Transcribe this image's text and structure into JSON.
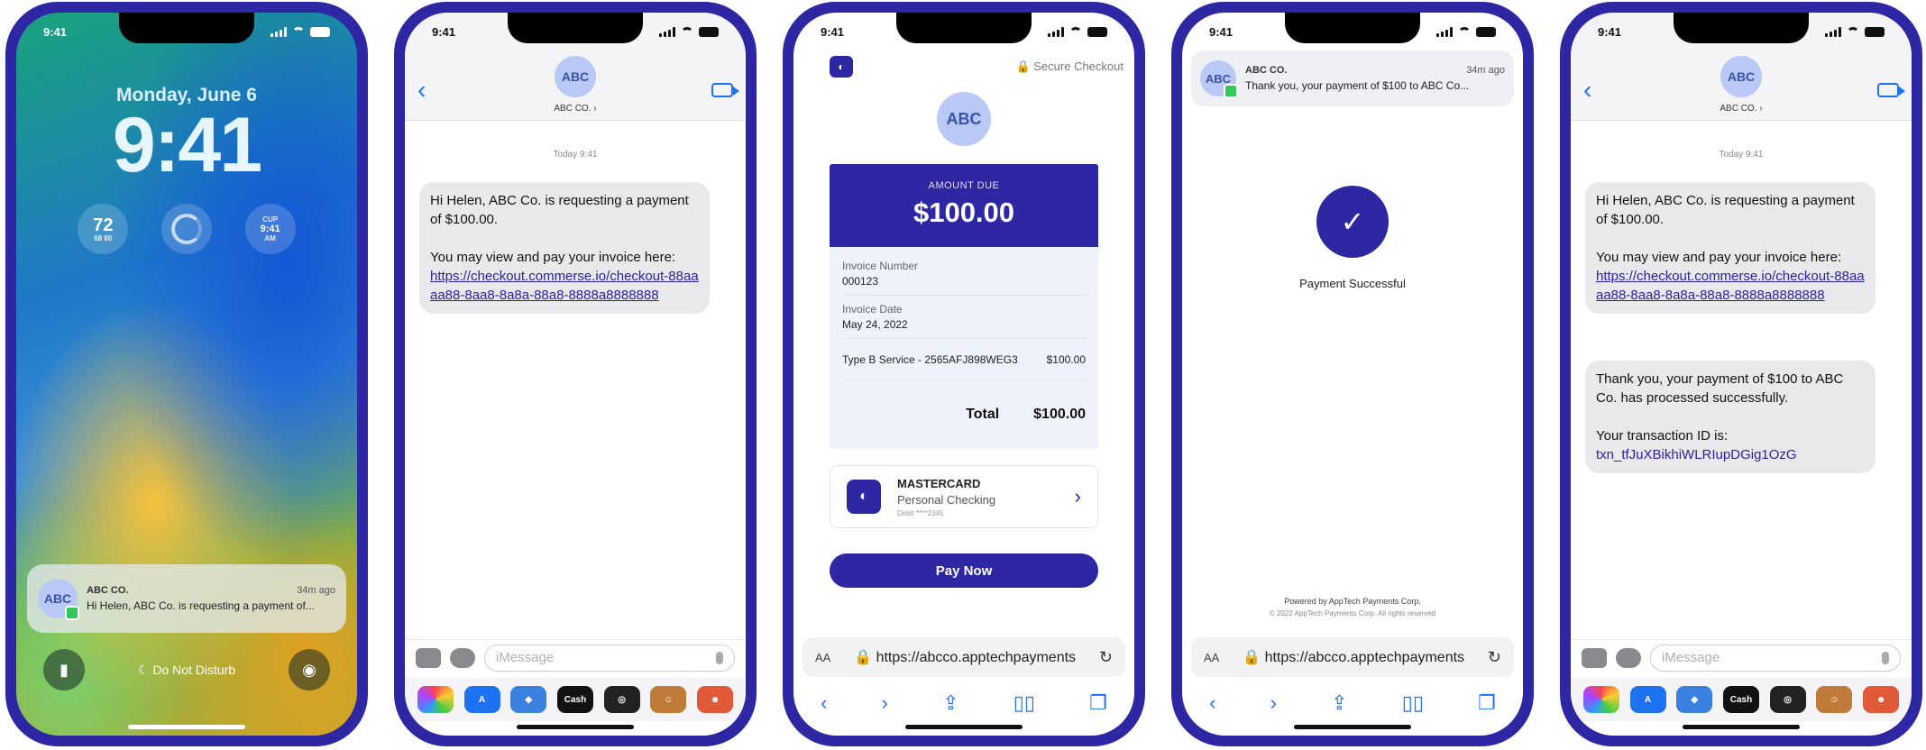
{
  "status_time": "9:41",
  "lock": {
    "date": "Monday, June 6",
    "time": "9:41",
    "weather_temp": "72",
    "weather_sub": "68 80",
    "clock_top": "CUP",
    "clock_time": "9:41",
    "clock_ampm": "AM",
    "focus_label": "Do Not Disturb",
    "notification": {
      "avatar": "ABC",
      "sender": "ABC CO.",
      "ago": "34m ago",
      "text": "Hi Helen, ABC Co. is requesting a payment of..."
    }
  },
  "messages": {
    "avatar": "ABC",
    "contact": "ABC CO. ›",
    "timestamp": "Today 9:41",
    "bubble1": {
      "line1": "Hi Helen, ABC Co. is requesting a payment of $100.00.",
      "line2": "You may view and pay your invoice here:",
      "link": "https://checkout.commerse.io/checkout-88aaaa88-8aa8-8a8a-88a8-8888a8888888"
    },
    "bubble2": {
      "line1": "Thank you, your payment of $100 to ABC Co. has processed successfully.",
      "line2": "Your transaction ID is:",
      "txn": "txn_tfJuXBikhiWLRIupDGig1OzG"
    },
    "compose_placeholder": "iMessage",
    "apps": [
      "photos",
      "app-store",
      "memoji",
      "Cash",
      "fitness",
      "animoji",
      "stickers"
    ],
    "app_cash_label": "Cash"
  },
  "checkout": {
    "secure_label": "Secure Checkout",
    "avatar": "ABC",
    "amount_label": "AMOUNT DUE",
    "amount": "$100.00",
    "invoice_number_label": "Invoice Number",
    "invoice_number": "000123",
    "invoice_date_label": "Invoice Date",
    "invoice_date": "May 24, 2022",
    "service": "Type B Service - 2565AFJ898WEG3",
    "service_price": "$100.00",
    "total_label": "Total",
    "total": "$100.00",
    "card_brand": "MASTERCARD",
    "card_account": "Personal Checking",
    "card_number": "Debit ****2345",
    "pay_button": "Pay Now"
  },
  "browser": {
    "aa": "AA",
    "url": "https://abcco.apptechpayments"
  },
  "success": {
    "avatar": "ABC",
    "sender": "ABC CO.",
    "ago": "34m ago",
    "notif_text": "Thank you, your payment of $100 to ABC Co...",
    "message": "Payment Successful",
    "powered": "Powered by AppTech Payments Corp.",
    "copyright": "© 2022 AppTech Payments Corp. All rights reserved"
  },
  "colors": {
    "brand": "#2e27a3",
    "link_blue": "#1d72f2"
  }
}
